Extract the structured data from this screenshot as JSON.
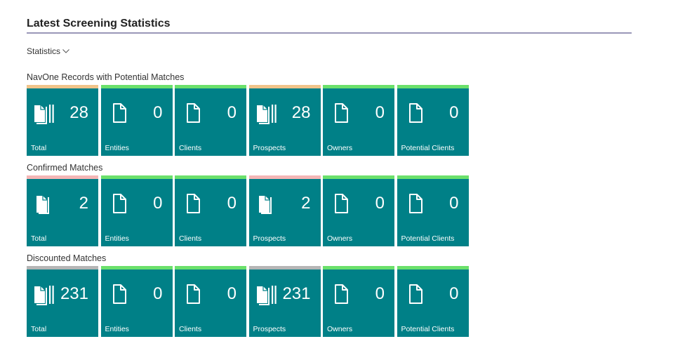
{
  "page": {
    "title": "Latest Screening Statistics"
  },
  "toolbar": {
    "statistics_label": "Statistics"
  },
  "colors": {
    "tile": "#008087",
    "indicator_green": "#6be06b",
    "indicator_orange": "#f0c48a",
    "indicator_pink": "#f4b6b6",
    "indicator_gray": "#b5b5b5"
  },
  "sections": [
    {
      "label": "NavOne Records with Potential Matches",
      "tiles": [
        {
          "label": "Total",
          "value": "28",
          "icon": "multi-document-icon",
          "indicator": "orange"
        },
        {
          "label": "Entities",
          "value": "0",
          "icon": "document-icon",
          "indicator": "green"
        },
        {
          "label": "Clients",
          "value": "0",
          "icon": "document-icon",
          "indicator": "green"
        },
        {
          "label": "Prospects",
          "value": "28",
          "icon": "multi-document-icon",
          "indicator": "orange"
        },
        {
          "label": "Owners",
          "value": "0",
          "icon": "document-icon",
          "indicator": "green"
        },
        {
          "label": "Potential Clients",
          "value": "0",
          "icon": "document-icon",
          "indicator": "green"
        }
      ]
    },
    {
      "label": "Confirmed Matches",
      "tiles": [
        {
          "label": "Total",
          "value": "2",
          "icon": "double-document-icon",
          "indicator": "pink"
        },
        {
          "label": "Entities",
          "value": "0",
          "icon": "document-icon",
          "indicator": "green"
        },
        {
          "label": "Clients",
          "value": "0",
          "icon": "document-icon",
          "indicator": "green"
        },
        {
          "label": "Prospects",
          "value": "2",
          "icon": "double-document-icon",
          "indicator": "pink"
        },
        {
          "label": "Owners",
          "value": "0",
          "icon": "document-icon",
          "indicator": "green"
        },
        {
          "label": "Potential Clients",
          "value": "0",
          "icon": "document-icon",
          "indicator": "green"
        }
      ]
    },
    {
      "label": "Discounted Matches",
      "tiles": [
        {
          "label": "Total",
          "value": "231",
          "icon": "multi-document-icon",
          "indicator": "gray"
        },
        {
          "label": "Entities",
          "value": "0",
          "icon": "document-icon",
          "indicator": "green"
        },
        {
          "label": "Clients",
          "value": "0",
          "icon": "document-icon",
          "indicator": "green"
        },
        {
          "label": "Prospects",
          "value": "231",
          "icon": "multi-document-icon",
          "indicator": "gray"
        },
        {
          "label": "Owners",
          "value": "0",
          "icon": "document-icon",
          "indicator": "green"
        },
        {
          "label": "Potential Clients",
          "value": "0",
          "icon": "document-icon",
          "indicator": "green"
        }
      ]
    }
  ]
}
